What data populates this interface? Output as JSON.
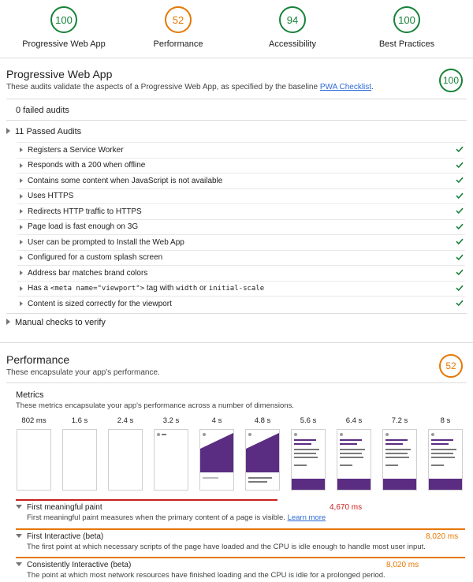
{
  "top_scores": [
    {
      "score": "100",
      "label": "Progressive Web App",
      "color": "#178239"
    },
    {
      "score": "52",
      "label": "Performance",
      "color": "#e67700"
    },
    {
      "score": "94",
      "label": "Accessibility",
      "color": "#178239"
    },
    {
      "score": "100",
      "label": "Best Practices",
      "color": "#178239"
    }
  ],
  "pwa": {
    "title": "Progressive Web App",
    "description": "These audits validate the aspects of a Progressive Web App, as specified by the baseline",
    "link_text": "PWA Checklist",
    "description_end": ".",
    "score": "100",
    "failed": "0 failed audits",
    "passed_header": "11 Passed Audits",
    "audits": [
      "Registers a Service Worker",
      "Responds with a 200 when offline",
      "Contains some content when JavaScript is not available",
      "Uses HTTPS",
      "Redirects HTTP traffic to HTTPS",
      "Page load is fast enough on 3G",
      "User can be prompted to Install the Web App",
      "Configured for a custom splash screen",
      "Address bar matches brand colors"
    ],
    "viewport_audit": {
      "pre": "Has a",
      "code1": "<meta name=\"viewport\">",
      "mid": "tag with",
      "code2": "width",
      "or": "or",
      "code3": "initial-scale"
    },
    "last_audit": "Content is sized correctly for the viewport",
    "manual": "Manual checks to verify"
  },
  "performance": {
    "title": "Performance",
    "description": "These encapsulate your app's performance.",
    "score": "52",
    "metrics_title": "Metrics",
    "metrics_desc": "These metrics encapsulate your app's performance across a number of dimensions.",
    "filmstrip": [
      "802 ms",
      "1.6 s",
      "2.4 s",
      "3.2 s",
      "4 s",
      "4.8 s",
      "5.6 s",
      "6.4 s",
      "7.2 s",
      "8 s"
    ],
    "metrics": [
      {
        "name": "First meaningful paint",
        "value": "4,670 ms",
        "value_color": "#c7221f",
        "bar_color": "#c7221f",
        "desc": "First meaningful paint measures when the primary content of a page is visible.",
        "link": "Learn more"
      },
      {
        "name": "First Interactive (beta)",
        "value": "8,020 ms",
        "value_color": "#e67700",
        "bar_color": "#e67700",
        "desc": "The first point at which necessary scripts of the page have loaded and the CPU is idle enough to handle most user input.",
        "link": ""
      },
      {
        "name": "Consistently Interactive (beta)",
        "value": "8,020 ms",
        "value_color": "#e67700",
        "bar_color": "#e67700",
        "desc": "The point at which most network resources have finished loading and the CPU is idle for a prolonged period.",
        "link": ""
      }
    ]
  }
}
